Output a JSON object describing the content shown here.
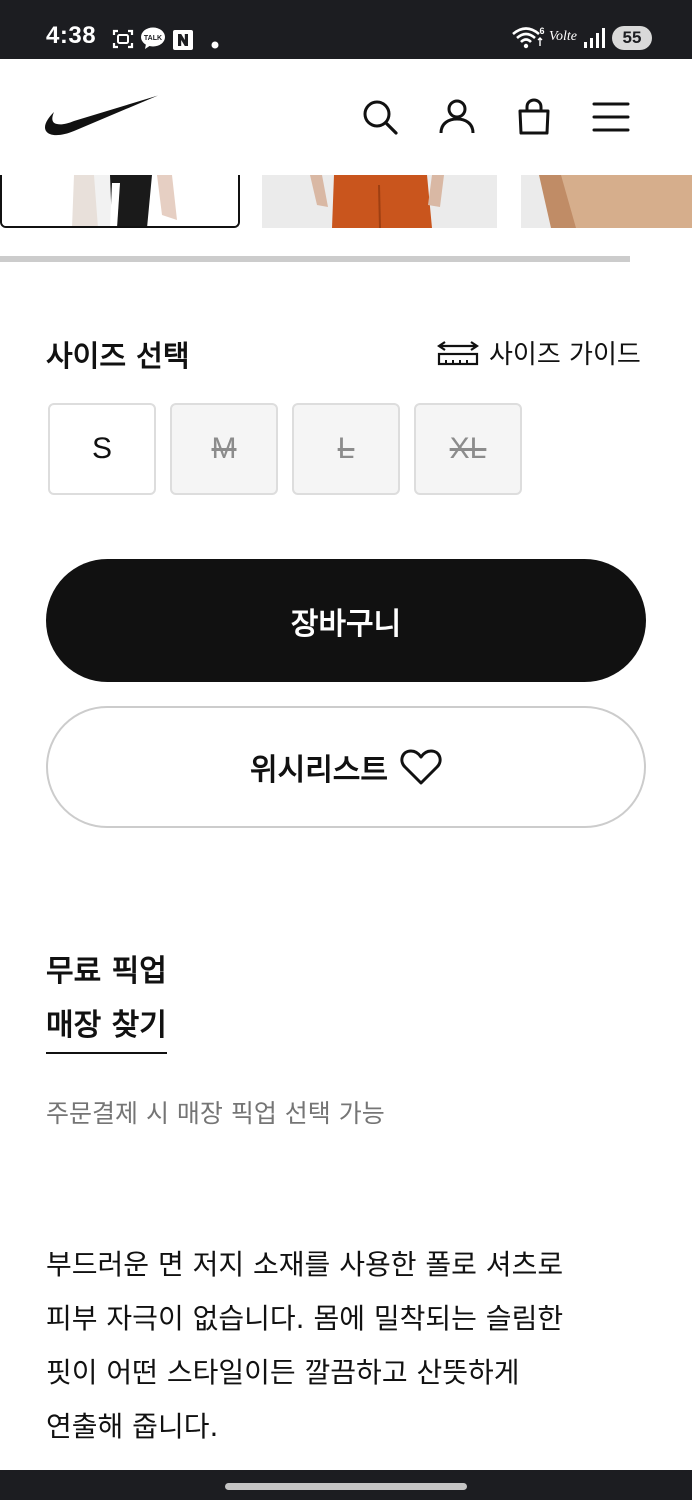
{
  "status_bar": {
    "time": "4:38",
    "battery": "55",
    "network_label": "Volte"
  },
  "header": {
    "brand": "nike-swoosh-logo",
    "icons": [
      "search-icon",
      "user-icon",
      "bag-icon",
      "menu-icon"
    ]
  },
  "size": {
    "title": "사이즈 선택",
    "guide_label": "사이즈 가이드",
    "options": [
      {
        "label": "S",
        "available": true
      },
      {
        "label": "M",
        "available": false
      },
      {
        "label": "L",
        "available": false
      },
      {
        "label": "XL",
        "available": false
      }
    ]
  },
  "actions": {
    "cart_label": "장바구니",
    "wishlist_label": "위시리스트"
  },
  "pickup": {
    "title": "무료 픽업",
    "store_link": "매장 찾기",
    "note": "주문결제 시 매장 픽업 선택 가능"
  },
  "description": {
    "lines": [
      "부드러운 면 저지 소재를 사용한 폴로 셔츠로",
      "피부 자극이 없습니다. 몸에 밀착되는 슬림한",
      "핏이 어떤 스타일이든 깔끔하고 산뜻하게",
      "연출해 줍니다."
    ]
  },
  "colors": {
    "accent": "#111111",
    "status_bar": "#1c1d21",
    "muted_text": "#757575",
    "border": "#cccccc"
  }
}
